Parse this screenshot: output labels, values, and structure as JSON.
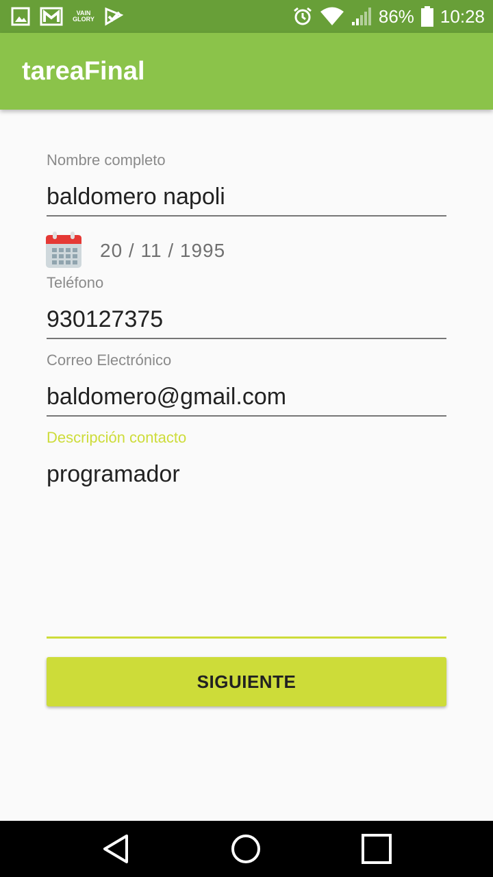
{
  "status_bar": {
    "notification_icons": [
      "gallery-icon",
      "gmail-icon",
      "vainglory-icon",
      "app-check-icon"
    ],
    "vainglory_text": [
      "VAIN",
      "GLORY"
    ],
    "right_icons": [
      "alarm-icon",
      "wifi-icon",
      "signal-icon",
      "battery-icon"
    ],
    "battery": "86%",
    "time": "10:28"
  },
  "app_bar": {
    "title": "tareaFinal"
  },
  "form": {
    "name": {
      "label": "Nombre completo",
      "value": "baldomero napoli"
    },
    "date": {
      "icon": "calendar-icon",
      "value": "20 / 11 / 1995"
    },
    "phone": {
      "label": "Teléfono",
      "value": "930127375"
    },
    "email": {
      "label": "Correo Electrónico",
      "value": "baldomero@gmail.com"
    },
    "description": {
      "label": "Descripción contacto",
      "value": "programador"
    }
  },
  "button": {
    "label": "SIGUIENTE"
  },
  "nav_bar": {
    "buttons": [
      "back-icon",
      "home-icon",
      "recents-icon"
    ]
  },
  "colors": {
    "status_bar": "#689f38",
    "app_bar": "#8bc34a",
    "accent": "#cddc39",
    "background": "#fafafa",
    "nav_bar": "#000000"
  }
}
